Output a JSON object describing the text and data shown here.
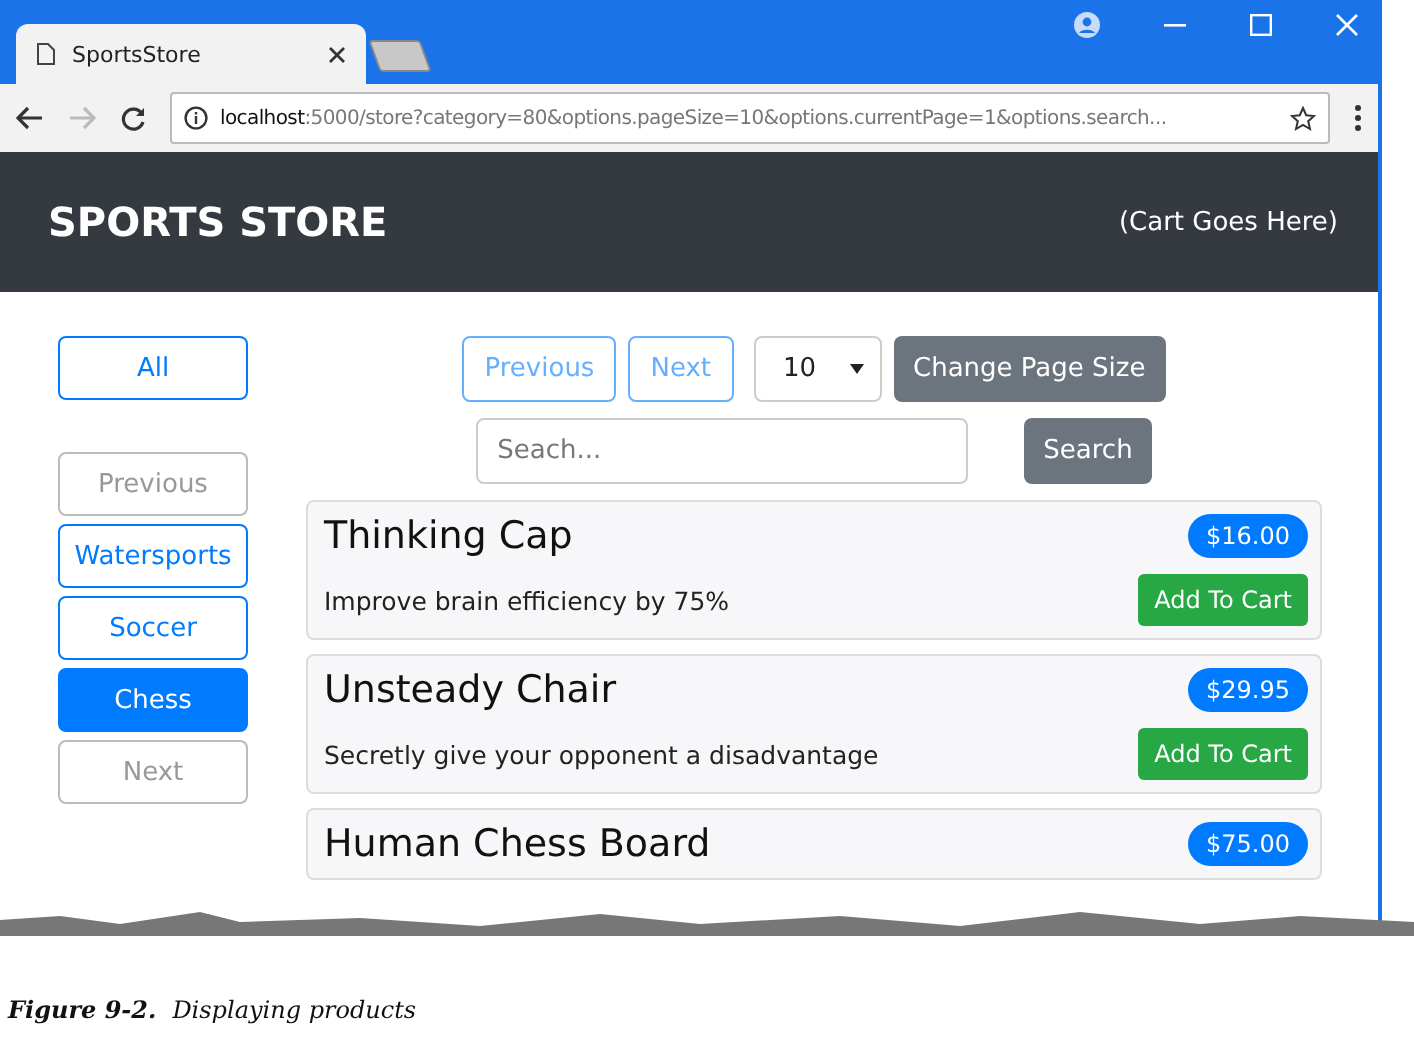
{
  "browser": {
    "tab": {
      "title": "SportsStore",
      "selected": true
    },
    "url_host": "localhost",
    "url_rest": ":5000/store?category=80&options.pageSize=10&options.currentPage=1&options.search..."
  },
  "header": {
    "title": "SPORTS STORE",
    "cart": "(Cart Goes Here)"
  },
  "categories": [
    {
      "label": "All",
      "selected": false,
      "disabled": false
    },
    {
      "label": "Previous",
      "selected": false,
      "disabled": true
    },
    {
      "label": "Watersports",
      "selected": false,
      "disabled": false
    },
    {
      "label": "Soccer",
      "selected": false,
      "disabled": false
    },
    {
      "label": "Chess",
      "selected": true,
      "disabled": false
    },
    {
      "label": "Next",
      "selected": false,
      "disabled": true
    }
  ],
  "pagination": {
    "buttons": [
      {
        "label": "Previous",
        "disabled": true
      },
      {
        "label": "Next",
        "disabled": true
      }
    ],
    "page_size": "10",
    "change_button": "Change Page Size"
  },
  "search": {
    "placeholder": "Seach...",
    "button": "Search"
  },
  "products": [
    {
      "name": "Thinking Cap",
      "price": "$16.00",
      "description": "Improve brain efficiency by 75%",
      "button": "Add To Cart"
    },
    {
      "name": "Unsteady Chair",
      "price": "$29.95",
      "description": "Secretly give your opponent a disadvantage",
      "button": "Add To Cart"
    },
    {
      "name": "Human Chess Board",
      "price": "$75.00"
    }
  ],
  "caption": {
    "label": "Figure 9-2.",
    "text": "Displaying products"
  }
}
